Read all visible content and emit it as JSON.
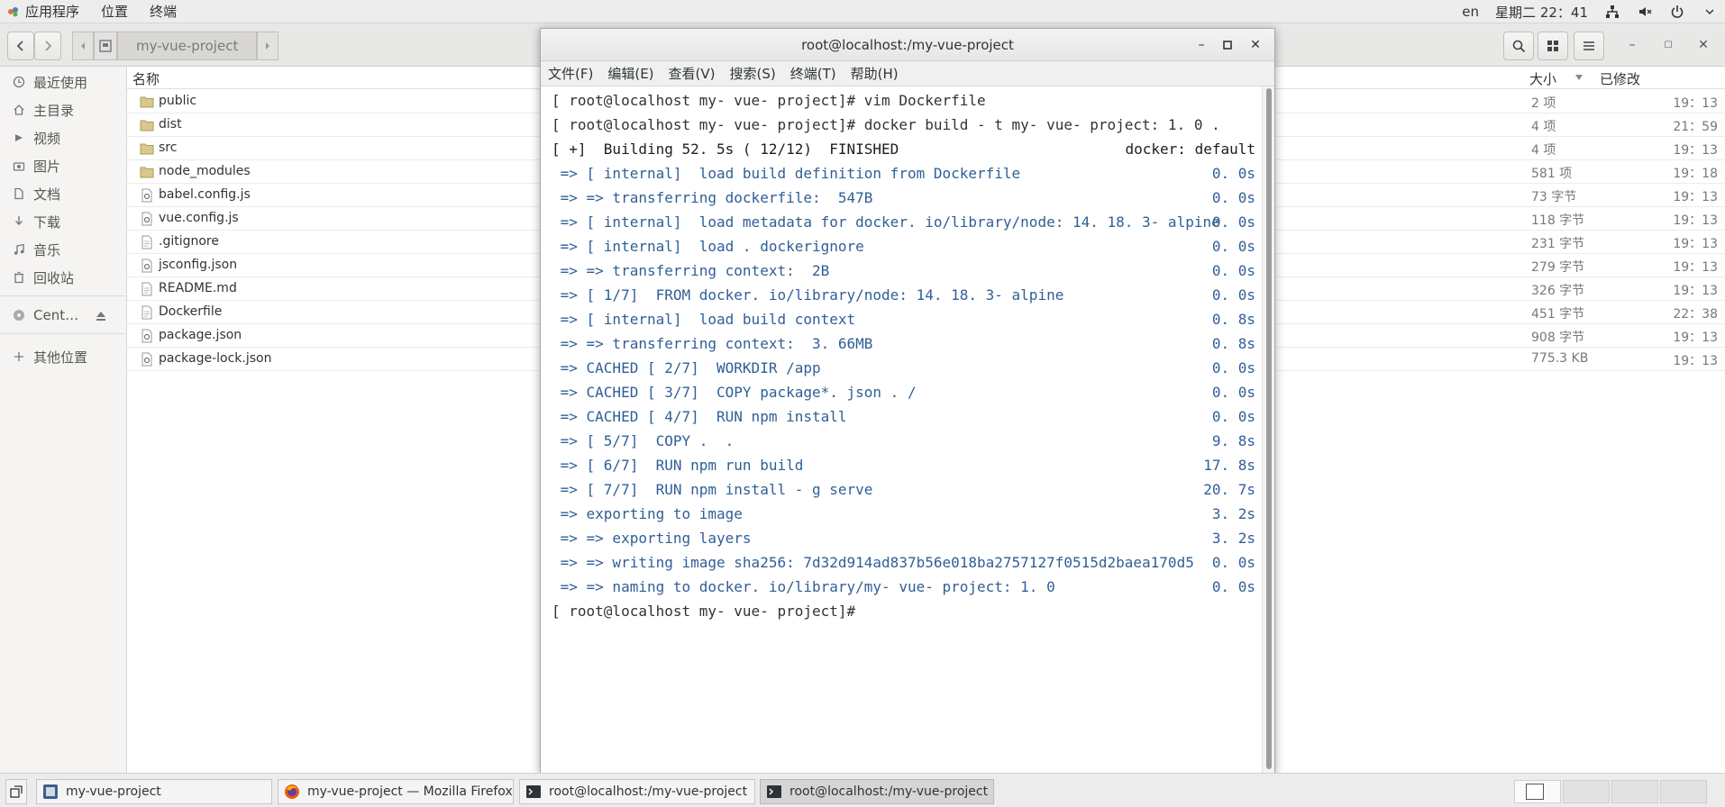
{
  "topbar": {
    "menus": [
      "应用程序",
      "位置",
      "终端"
    ],
    "lang": "en",
    "datetime": "星期二 22：41"
  },
  "filemanager": {
    "breadcrumb": "my-vue-project",
    "sidebar": [
      {
        "label": "最近使用",
        "icon": "clock-icon"
      },
      {
        "label": "主目录",
        "icon": "home-icon"
      },
      {
        "label": "视频",
        "icon": "video-icon"
      },
      {
        "label": "图片",
        "icon": "camera-icon"
      },
      {
        "label": "文档",
        "icon": "document-icon"
      },
      {
        "label": "下载",
        "icon": "download-icon"
      },
      {
        "label": "音乐",
        "icon": "music-icon"
      },
      {
        "label": "回收站",
        "icon": "trash-icon"
      }
    ],
    "device": {
      "label": "Cent…",
      "icon": "disk-icon"
    },
    "other": {
      "label": "其他位置",
      "icon": "plus-icon"
    },
    "columns": {
      "name": "名称",
      "size": "大小",
      "modified": "已修改"
    },
    "files": [
      {
        "name": "public",
        "type": "folder",
        "size": "2 项",
        "modified": "19：13"
      },
      {
        "name": "dist",
        "type": "folder",
        "size": "4 项",
        "modified": "21：59"
      },
      {
        "name": "src",
        "type": "folder",
        "size": "4 项",
        "modified": "19：13"
      },
      {
        "name": "node_modules",
        "type": "folder",
        "size": "581 项",
        "modified": "19：18"
      },
      {
        "name": "babel.config.js",
        "type": "script",
        "size": "73 字节",
        "modified": "19：13"
      },
      {
        "name": "vue.config.js",
        "type": "script",
        "size": "118 字节",
        "modified": "19：13"
      },
      {
        "name": ".gitignore",
        "type": "text",
        "size": "231 字节",
        "modified": "19：13"
      },
      {
        "name": "jsconfig.json",
        "type": "script",
        "size": "279 字节",
        "modified": "19：13"
      },
      {
        "name": "README.md",
        "type": "text",
        "size": "326 字节",
        "modified": "19：13"
      },
      {
        "name": "Dockerfile",
        "type": "text",
        "size": "451 字节",
        "modified": "22：38"
      },
      {
        "name": "package.json",
        "type": "script",
        "size": "908 字节",
        "modified": "19：13"
      },
      {
        "name": "package-lock.json",
        "type": "script",
        "size": "775.3 KB",
        "modified": "19：13"
      }
    ]
  },
  "terminal": {
    "title": "root@localhost:/my-vue-project",
    "menus": [
      "文件(F)",
      "编辑(E)",
      "查看(V)",
      "搜索(S)",
      "终端(T)",
      "帮助(H)"
    ],
    "lines": [
      {
        "left": "[ root@localhost my- vue- project]# vim Dockerfile",
        "right": "",
        "style": "prompt"
      },
      {
        "left": "[ root@localhost my- vue- project]# docker build - t my- vue- project: 1. 0 .",
        "right": "",
        "style": "prompt"
      },
      {
        "left": "[ +]  Building 52. 5s ( 12/12)  FINISHED",
        "right": "docker: default",
        "style": "black"
      },
      {
        "left": " => [ internal]  load build definition from Dockerfile",
        "right": "0. 0s",
        "style": "blue"
      },
      {
        "left": " => => transferring dockerfile:  547B",
        "right": "0. 0s",
        "style": "blue"
      },
      {
        "left": " => [ internal]  load metadata for docker. io/library/node: 14. 18. 3- alpine",
        "right": "0. 0s",
        "style": "blue"
      },
      {
        "left": " => [ internal]  load . dockerignore",
        "right": "0. 0s",
        "style": "blue"
      },
      {
        "left": " => => transferring context:  2B",
        "right": "0. 0s",
        "style": "blue"
      },
      {
        "left": " => [ 1/7]  FROM docker. io/library/node: 14. 18. 3- alpine",
        "right": "0. 0s",
        "style": "blue"
      },
      {
        "left": " => [ internal]  load build context",
        "right": "0. 8s",
        "style": "blue"
      },
      {
        "left": " => => transferring context:  3. 66MB",
        "right": "0. 8s",
        "style": "blue"
      },
      {
        "left": " => CACHED [ 2/7]  WORKDIR /app",
        "right": "0. 0s",
        "style": "blue"
      },
      {
        "left": " => CACHED [ 3/7]  COPY package*. json . /",
        "right": "0. 0s",
        "style": "blue"
      },
      {
        "left": " => CACHED [ 4/7]  RUN npm install",
        "right": "0. 0s",
        "style": "blue"
      },
      {
        "left": " => [ 5/7]  COPY .  .",
        "right": "9. 8s",
        "style": "blue"
      },
      {
        "left": " => [ 6/7]  RUN npm run build",
        "right": "17. 8s",
        "style": "blue"
      },
      {
        "left": " => [ 7/7]  RUN npm install - g serve",
        "right": "20. 7s",
        "style": "blue"
      },
      {
        "left": " => exporting to image",
        "right": "3. 2s",
        "style": "blue"
      },
      {
        "left": " => => exporting layers",
        "right": "3. 2s",
        "style": "blue"
      },
      {
        "left": " => => writing image sha256: 7d32d914ad837b56e018ba2757127f0515d2baea170d5",
        "right": "0. 0s",
        "style": "blue"
      },
      {
        "left": " => => naming to docker. io/library/my- vue- project: 1. 0",
        "right": "0. 0s",
        "style": "blue"
      },
      {
        "left": "[ root@localhost my- vue- project]#",
        "right": "",
        "style": "prompt"
      }
    ]
  },
  "taskbar": {
    "tasks": [
      {
        "label": "my-vue-project",
        "icon": "file-manager-icon",
        "active": false
      },
      {
        "label": "my-vue-project — Mozilla Firefox",
        "icon": "firefox-icon",
        "active": false
      },
      {
        "label": "root@localhost:/my-vue-project",
        "icon": "terminal-icon",
        "active": false
      },
      {
        "label": "root@localhost:/my-vue-project",
        "icon": "terminal-icon",
        "active": true
      }
    ]
  },
  "colors": {
    "terminal_blue": "#2f5f96",
    "folder": "#c9b26c"
  }
}
